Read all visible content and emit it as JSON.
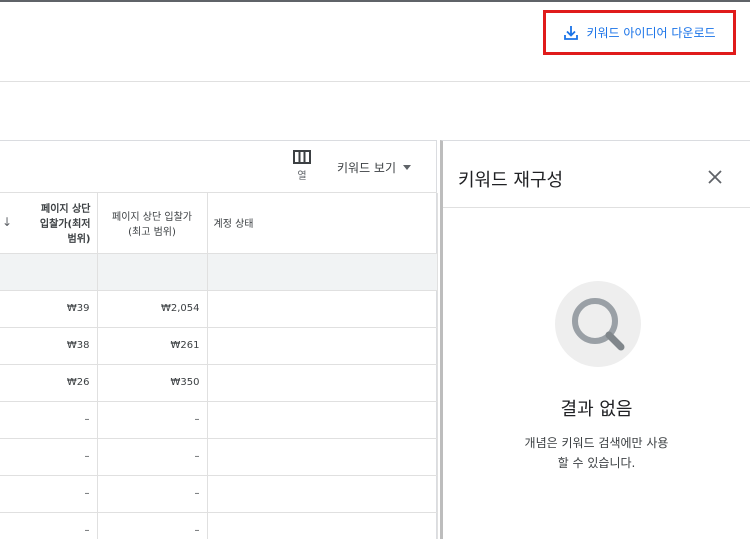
{
  "download_button": {
    "label": "키워드 아이디어 다운로드",
    "icon": "download-icon"
  },
  "toolbar": {
    "columns_label": "열",
    "columns_icon": "columns-icon",
    "view_label": "키워드 보기"
  },
  "table": {
    "headers": [
      "페이지 상단 입찰가(최저 범위)",
      "페이지 상단 입찰가 (최고 범위)",
      "계정 상태"
    ],
    "header_lines": {
      "c1": [
        "페이지 상단",
        "입찰가(최저",
        "범위)"
      ],
      "c2": [
        "페이지 상단 입찰가",
        "(최고 범위)"
      ],
      "c3": [
        "계정 상태"
      ]
    },
    "rows": [
      {
        "low": "₩39",
        "high": "₩2,054",
        "status": ""
      },
      {
        "low": "₩38",
        "high": "₩261",
        "status": ""
      },
      {
        "low": "₩26",
        "high": "₩350",
        "status": ""
      },
      {
        "low": "–",
        "high": "–",
        "status": ""
      },
      {
        "low": "–",
        "high": "–",
        "status": ""
      },
      {
        "low": "–",
        "high": "–",
        "status": ""
      },
      {
        "low": "–",
        "high": "–",
        "status": ""
      }
    ]
  },
  "panel": {
    "title": "키워드 재구성",
    "empty_title": "결과 없음",
    "empty_desc_1": "개념은 키워드 검색에만 사용",
    "empty_desc_2": "할 수 있습니다."
  },
  "colors": {
    "accent": "#1a73e8",
    "highlight": "#e01b1b"
  }
}
